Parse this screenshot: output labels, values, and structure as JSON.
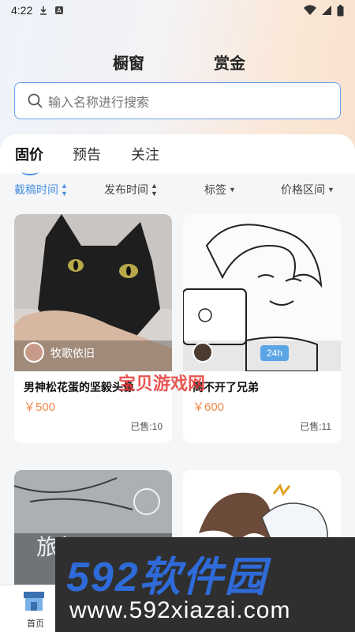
{
  "status": {
    "time": "4:22"
  },
  "tabs": [
    "橱窗",
    "赏金"
  ],
  "search": {
    "placeholder": "输入名称进行搜索"
  },
  "subtabs": [
    "固价",
    "预告",
    "关注"
  ],
  "filters": [
    "截稿时间",
    "发布时间",
    "标签",
    "价格区间"
  ],
  "cards": [
    {
      "author": "牧歌依旧",
      "title": "男神松花蛋的坚毅头像",
      "price": "￥500",
      "sold": "已售:10"
    },
    {
      "badge": "24h",
      "title": "离不开了兄弟",
      "price": "￥600",
      "sold": "已售:11"
    },
    {
      "image_text": "旅行"
    },
    {}
  ],
  "watermark": "宝贝游戏网",
  "banner": {
    "brand": "592软件园",
    "url": "www.592xiazai.com"
  },
  "nav": {
    "home": "首页"
  },
  "colors": {
    "accent": "#4a90e2",
    "price": "#f08a4b",
    "badge": "#5aa5e6"
  }
}
